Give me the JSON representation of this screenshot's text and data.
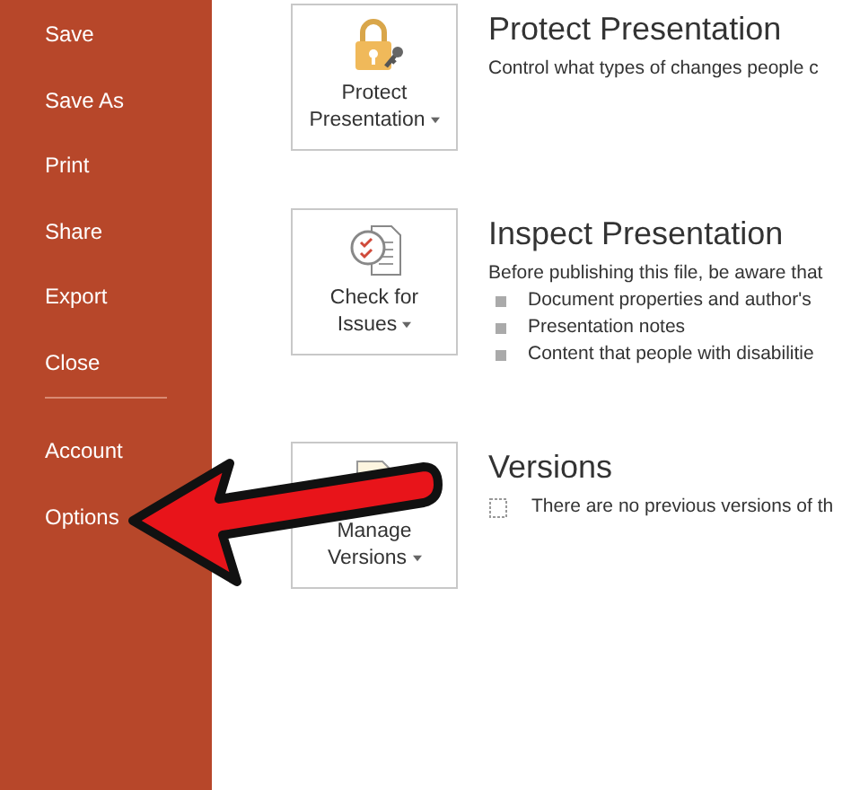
{
  "sidebar": {
    "groups": [
      {
        "items": [
          {
            "label": "Save"
          },
          {
            "label": "Save As"
          },
          {
            "label": "Print"
          },
          {
            "label": "Share"
          },
          {
            "label": "Export"
          },
          {
            "label": "Close"
          }
        ]
      },
      {
        "items": [
          {
            "label": "Account"
          },
          {
            "label": "Options"
          }
        ]
      }
    ]
  },
  "sections": [
    {
      "kind": "lock",
      "button_lines": [
        "Protect",
        "Presentation"
      ],
      "title": "Protect Presentation",
      "description": "Control what types of changes people c"
    },
    {
      "kind": "inspect",
      "button_lines": [
        "Check for",
        "Issues"
      ],
      "title": "Inspect Presentation",
      "description": "Before publishing this file, be aware that",
      "bullets": [
        "Document properties and author's",
        "Presentation notes",
        "Content that people with disabilitie"
      ]
    },
    {
      "kind": "versions",
      "button_lines": [
        "Manage",
        "Versions"
      ],
      "title": "Versions",
      "note": "There are no previous versions of th"
    }
  ],
  "annotation": {
    "kind": "arrow"
  }
}
